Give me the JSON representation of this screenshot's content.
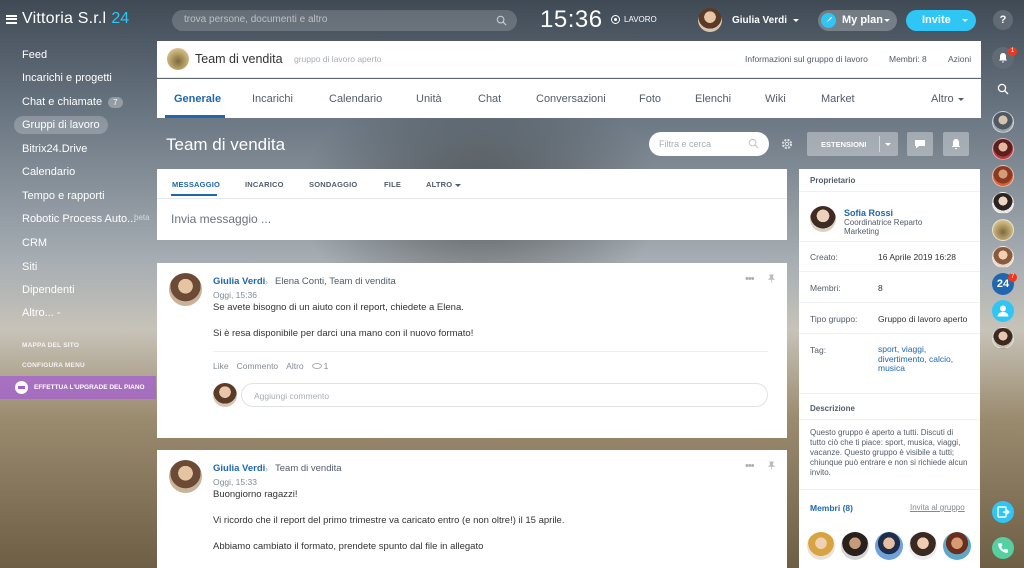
{
  "topbar": {
    "company": "Vittoria S.r.l",
    "plan_number": "24",
    "search_placeholder": "trova persone, documenti e altro",
    "clock": "15:36",
    "work_status": "LAVORO",
    "user_name": "Giulia Verdi",
    "myplan_label": "My plan",
    "invite_label": "Invite",
    "help_label": "?"
  },
  "leftmenu": {
    "items": [
      {
        "label": "Feed"
      },
      {
        "label": "Incarichi e progetti"
      },
      {
        "label": "Chat e chiamate",
        "badge": "7"
      },
      {
        "label": "Gruppi di lavoro"
      },
      {
        "label": "Bitrix24.Drive"
      },
      {
        "label": "Calendario"
      },
      {
        "label": "Tempo e rapporti"
      },
      {
        "label": "Robotic Process Auto..."
      },
      {
        "label": "CRM"
      },
      {
        "label": "Siti"
      },
      {
        "label": "Dipendenti"
      },
      {
        "label": "Altro... -"
      }
    ],
    "beta_label": "beta",
    "sitemap": "MAPPA DEL SITO",
    "configure": "CONFIGURA MENU",
    "upgrade": "EFFETTUA L'UPGRADE DEL PIANO"
  },
  "group": {
    "title": "Team di vendita",
    "type": "gruppo di lavoro aperto",
    "info_link": "Informazioni sul gruppo di lavoro",
    "members_label": "Membri: 8",
    "actions_label": "Azioni"
  },
  "tabs": [
    {
      "label": "Generale"
    },
    {
      "label": "Incarichi"
    },
    {
      "label": "Calendario"
    },
    {
      "label": "Unità"
    },
    {
      "label": "Chat"
    },
    {
      "label": "Conversazioni"
    },
    {
      "label": "Foto"
    },
    {
      "label": "Elenchi"
    },
    {
      "label": "Wiki"
    },
    {
      "label": "Market"
    },
    {
      "label": "Altro"
    }
  ],
  "page": {
    "title": "Team di vendita",
    "filter_placeholder": "Filtra e cerca",
    "extensions_label": "ESTENSIONI"
  },
  "composer": {
    "tabs": [
      {
        "label": "MESSAGGIO"
      },
      {
        "label": "INCARICO"
      },
      {
        "label": "SONDAGGIO"
      },
      {
        "label": "FILE"
      },
      {
        "label": "ALTRO"
      }
    ],
    "placeholder": "Invia messaggio ..."
  },
  "posts": [
    {
      "author": "Giulia Verdi",
      "recipients": "Elena Conti, Team di vendita",
      "time": "Oggi, 15:36",
      "lines": [
        "Se avete bisogno di un aiuto con il report, chiedete a Elena.",
        "Si è resa disponibile per darci una mano con il nuovo formato!"
      ],
      "actions": {
        "like": "Like",
        "comment": "Commento",
        "more": "Altro",
        "views": "1"
      },
      "comment_placeholder": "Aggiungi commento"
    },
    {
      "author": "Giulia Verdi",
      "recipients": "Team di vendita",
      "time": "Oggi, 15:33",
      "lines": [
        "Buongiorno ragazzi!",
        "Vi ricordo che il report del primo trimestre va caricato entro (e non oltre!) il 15 aprile.",
        "Abbiamo cambiato il formato, prendete spunto dal file in allegato"
      ]
    }
  ],
  "rightpanel": {
    "owner_heading": "Proprietario",
    "owner_name": "Sofia Rossi",
    "owner_role": "Coordinatrice Reparto Marketing",
    "created_label": "Creato:",
    "created_value": "16 Aprile 2019 16:28",
    "members_label": "Membri:",
    "members_value": "8",
    "type_label": "Tipo gruppo:",
    "type_value": "Gruppo di lavoro aperto",
    "tags_label": "Tag:",
    "tags_value": "sport, viaggi, divertimento, calcio, musica",
    "description_heading": "Descrizione",
    "description": "Questo gruppo è aperto a tutti. Discuti di tutto ciò che ti piace: sport, musica, viaggi, vacanze. Questo gruppo è visibile a tutti; chiunque può entrare e non si richiede alcun invito.",
    "members_heading": "Membri (8)",
    "invite_link": "Invita al gruppo"
  },
  "rightbar": {
    "notification_badge": "1",
    "chat_badge": "7",
    "b24_label": "24"
  },
  "colors": {
    "accent": "#2fc6f6",
    "link": "#2067b0",
    "upgrade": "#a65fd2",
    "phone": "#55d0a0"
  }
}
